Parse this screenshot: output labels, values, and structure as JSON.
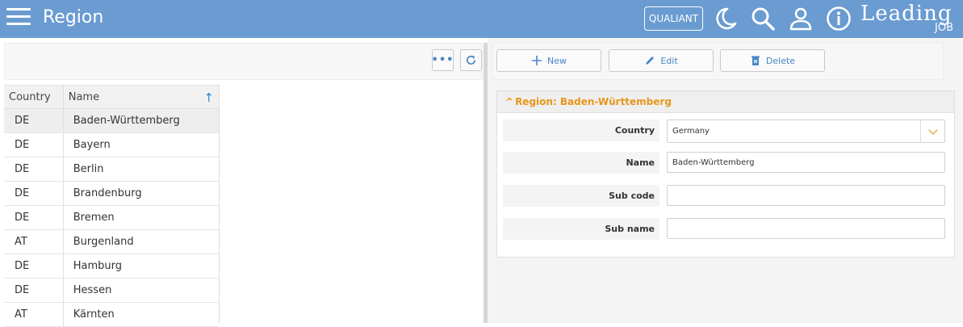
{
  "header": {
    "title": "Region",
    "qualiant_label": "QUALIANT",
    "logo_main": "Leading",
    "logo_sub": "JOB",
    "icons": [
      "menu-icon",
      "moon-icon",
      "search-icon",
      "user-icon",
      "info-icon"
    ],
    "background_color": "#6a9bd1"
  },
  "left_toolbar": {
    "more_icon": "ellipsis-icon",
    "refresh_icon": "refresh-icon"
  },
  "grid": {
    "columns": [
      "Country",
      "Name"
    ],
    "rows": [
      {
        "country": "DE",
        "name": "Baden-Württemberg"
      },
      {
        "country": "DE",
        "name": "Bayern"
      },
      {
        "country": "DE",
        "name": "Berlin"
      },
      {
        "country": "DE",
        "name": "Brandenburg"
      },
      {
        "country": "DE",
        "name": "Bremen"
      },
      {
        "country": "AT",
        "name": "Burgenland"
      },
      {
        "country": "DE",
        "name": "Hamburg"
      },
      {
        "country": "DE",
        "name": "Hessen"
      },
      {
        "country": "AT",
        "name": "Kärnten"
      }
    ],
    "selected_index": 0
  },
  "actions": {
    "new_label": "New",
    "edit_label": "Edit",
    "delete_label": "Delete",
    "accent_color": "#4a86c8"
  },
  "form": {
    "title": "Region: Baden-Württemberg",
    "title_color": "#e8961b",
    "country_label": "Country",
    "country_value": "Germany",
    "name_label": "Name",
    "name_value": "Baden-Württemberg",
    "subcode_label": "Sub code",
    "subcode_value": "",
    "subname_label": "Sub name",
    "subname_value": ""
  }
}
